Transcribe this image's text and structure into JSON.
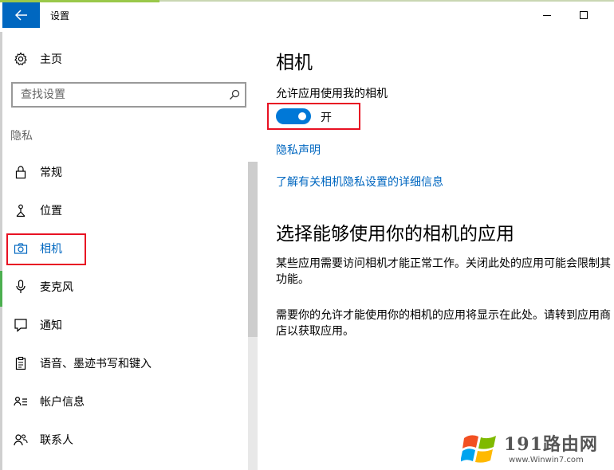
{
  "window": {
    "title": "设置"
  },
  "sidebar": {
    "home_label": "主页",
    "search_placeholder": "查找设置",
    "section_label": "隐私",
    "items": [
      {
        "label": "常规",
        "icon": "lock-icon"
      },
      {
        "label": "位置",
        "icon": "location-icon"
      },
      {
        "label": "相机",
        "icon": "camera-icon",
        "active": true
      },
      {
        "label": "麦克风",
        "icon": "microphone-icon"
      },
      {
        "label": "通知",
        "icon": "notification-icon"
      },
      {
        "label": "语音、墨迹书写和键入",
        "icon": "speech-inking-icon"
      },
      {
        "label": "帐户信息",
        "icon": "account-info-icon"
      },
      {
        "label": "联系人",
        "icon": "contacts-icon"
      }
    ]
  },
  "main": {
    "title": "相机",
    "toggle_label": "允许应用使用我的相机",
    "toggle_state": "开",
    "toggle_on": true,
    "link_privacy": "隐私声明",
    "link_learn_more": "了解有关相机隐私设置的详细信息",
    "section_heading": "选择能够使用你的相机的应用",
    "para1": "某些应用需要访问相机才能正常工作。关闭此处的应用可能会限制其功能。",
    "para2": "需要你的允许才能使用你的相机的应用将显示在此处。请转到应用商店以获取应用。"
  },
  "watermark": {
    "text": "191路由网",
    "url": "www.Winwin7.com"
  },
  "colors": {
    "accent": "#0078d7",
    "link": "#0067c0",
    "highlight_box": "#e81123",
    "back_button": "#0067c0"
  }
}
